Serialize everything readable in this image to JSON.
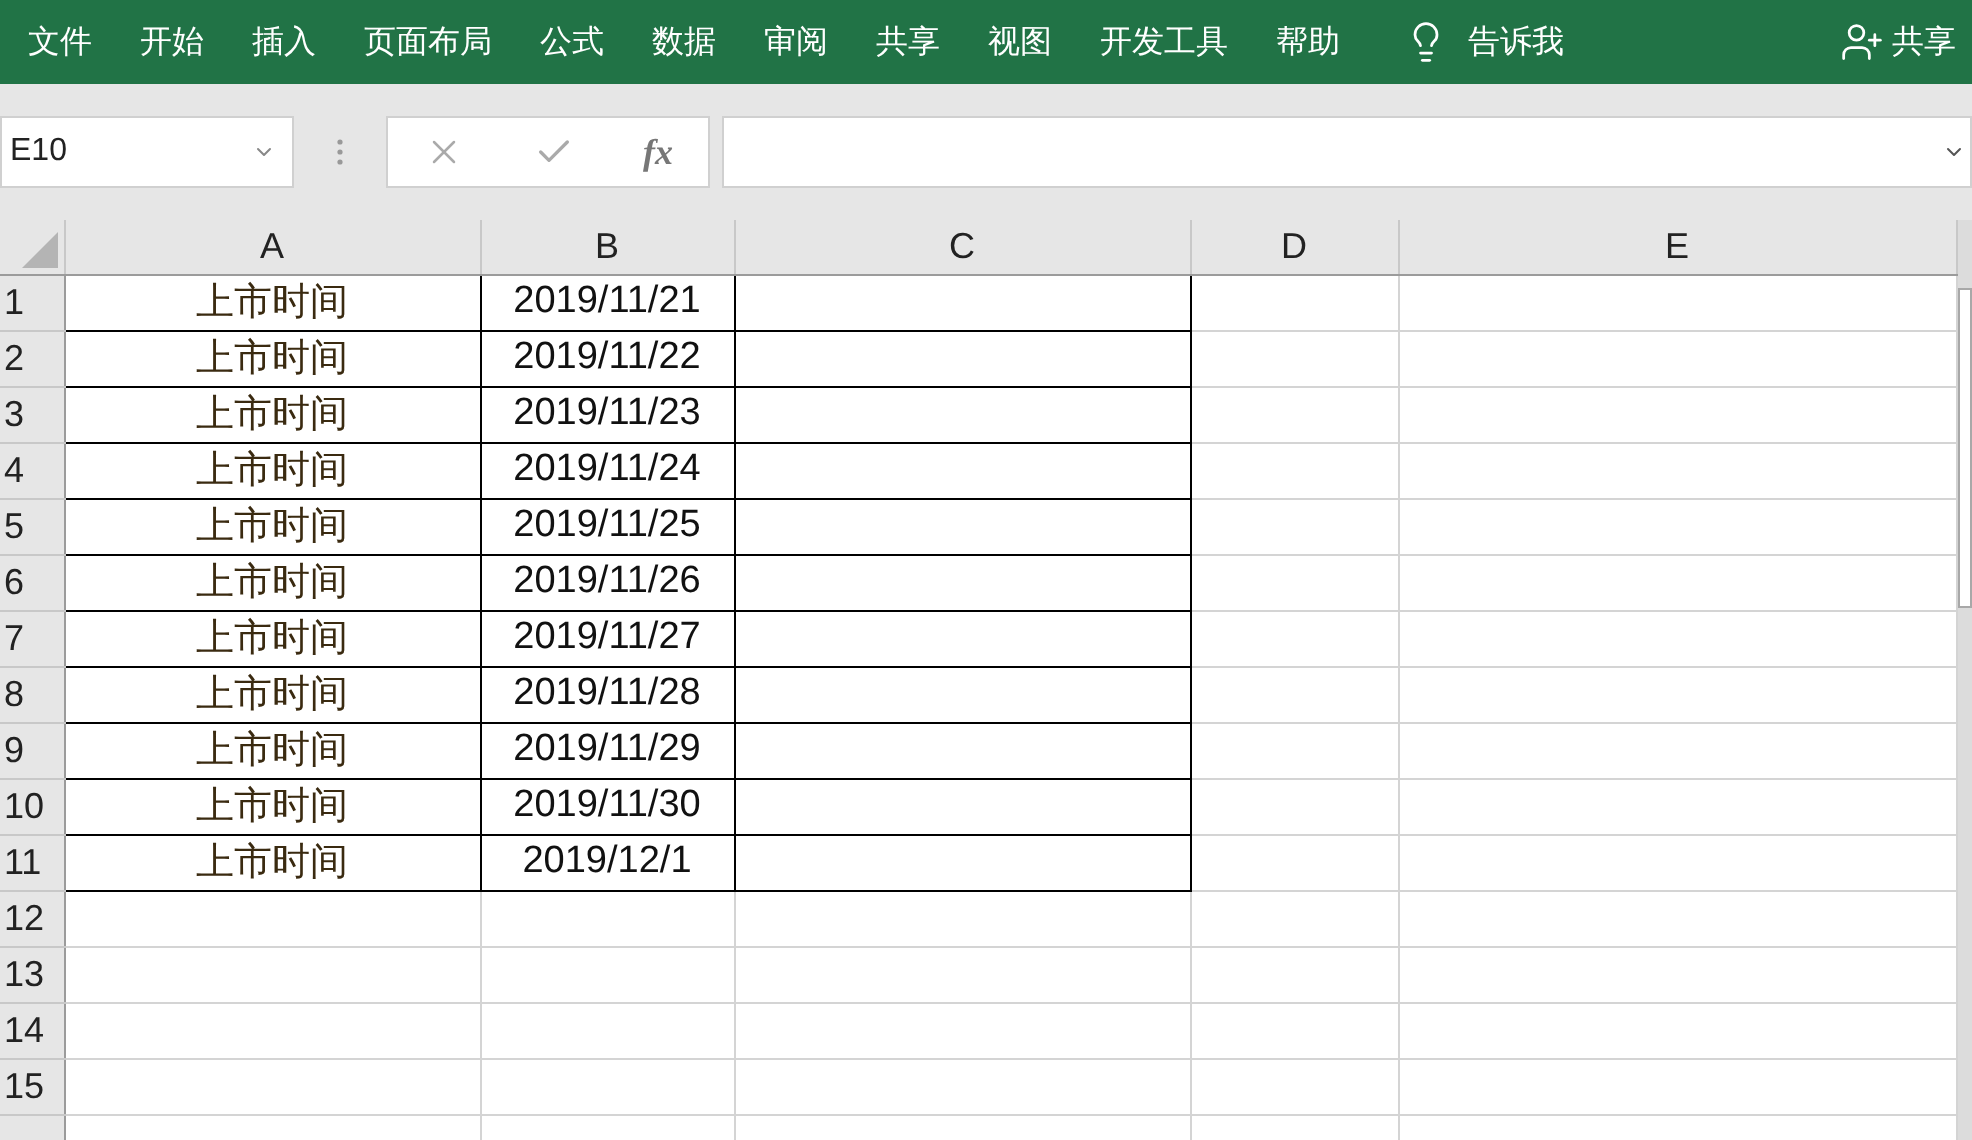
{
  "ribbon_tabs": [
    {
      "label": "文件"
    },
    {
      "label": "开始"
    },
    {
      "label": "插入"
    },
    {
      "label": "页面布局"
    },
    {
      "label": "公式"
    },
    {
      "label": "数据"
    },
    {
      "label": "审阅"
    },
    {
      "label": "共享"
    },
    {
      "label": "视图"
    },
    {
      "label": "开发工具"
    },
    {
      "label": "帮助"
    }
  ],
  "tell_me": "告诉我",
  "share": "共享",
  "name_box": "E10",
  "formula_fx": "fx",
  "columns": [
    "A",
    "B",
    "C",
    "D",
    "E"
  ],
  "rows": [
    {
      "header": "1",
      "bordered": true,
      "cells": [
        "上市时间",
        "2019/11/21"
      ]
    },
    {
      "header": "2",
      "bordered": true,
      "cells": [
        "上市时间",
        "2019/11/22"
      ]
    },
    {
      "header": "3",
      "bordered": true,
      "cells": [
        "上市时间",
        "2019/11/23"
      ]
    },
    {
      "header": "4",
      "bordered": true,
      "cells": [
        "上市时间",
        "2019/11/24"
      ]
    },
    {
      "header": "5",
      "bordered": true,
      "cells": [
        "上市时间",
        "2019/11/25"
      ]
    },
    {
      "header": "6",
      "bordered": true,
      "cells": [
        "上市时间",
        "2019/11/26"
      ]
    },
    {
      "header": "7",
      "bordered": true,
      "cells": [
        "上市时间",
        "2019/11/27"
      ]
    },
    {
      "header": "8",
      "bordered": true,
      "cells": [
        "上市时间",
        "2019/11/28"
      ]
    },
    {
      "header": "9",
      "bordered": true,
      "cells": [
        "上市时间",
        "2019/11/29"
      ]
    },
    {
      "header": "10",
      "bordered": true,
      "cells": [
        "上市时间",
        "2019/11/30"
      ]
    },
    {
      "header": "11",
      "bordered": true,
      "cells": [
        "上市时间",
        "2019/12/1"
      ]
    },
    {
      "header": "12",
      "bordered": false
    },
    {
      "header": "13",
      "bordered": false
    },
    {
      "header": "14",
      "bordered": false
    },
    {
      "header": "15",
      "bordered": false
    },
    {
      "header": "",
      "bordered": false
    }
  ]
}
